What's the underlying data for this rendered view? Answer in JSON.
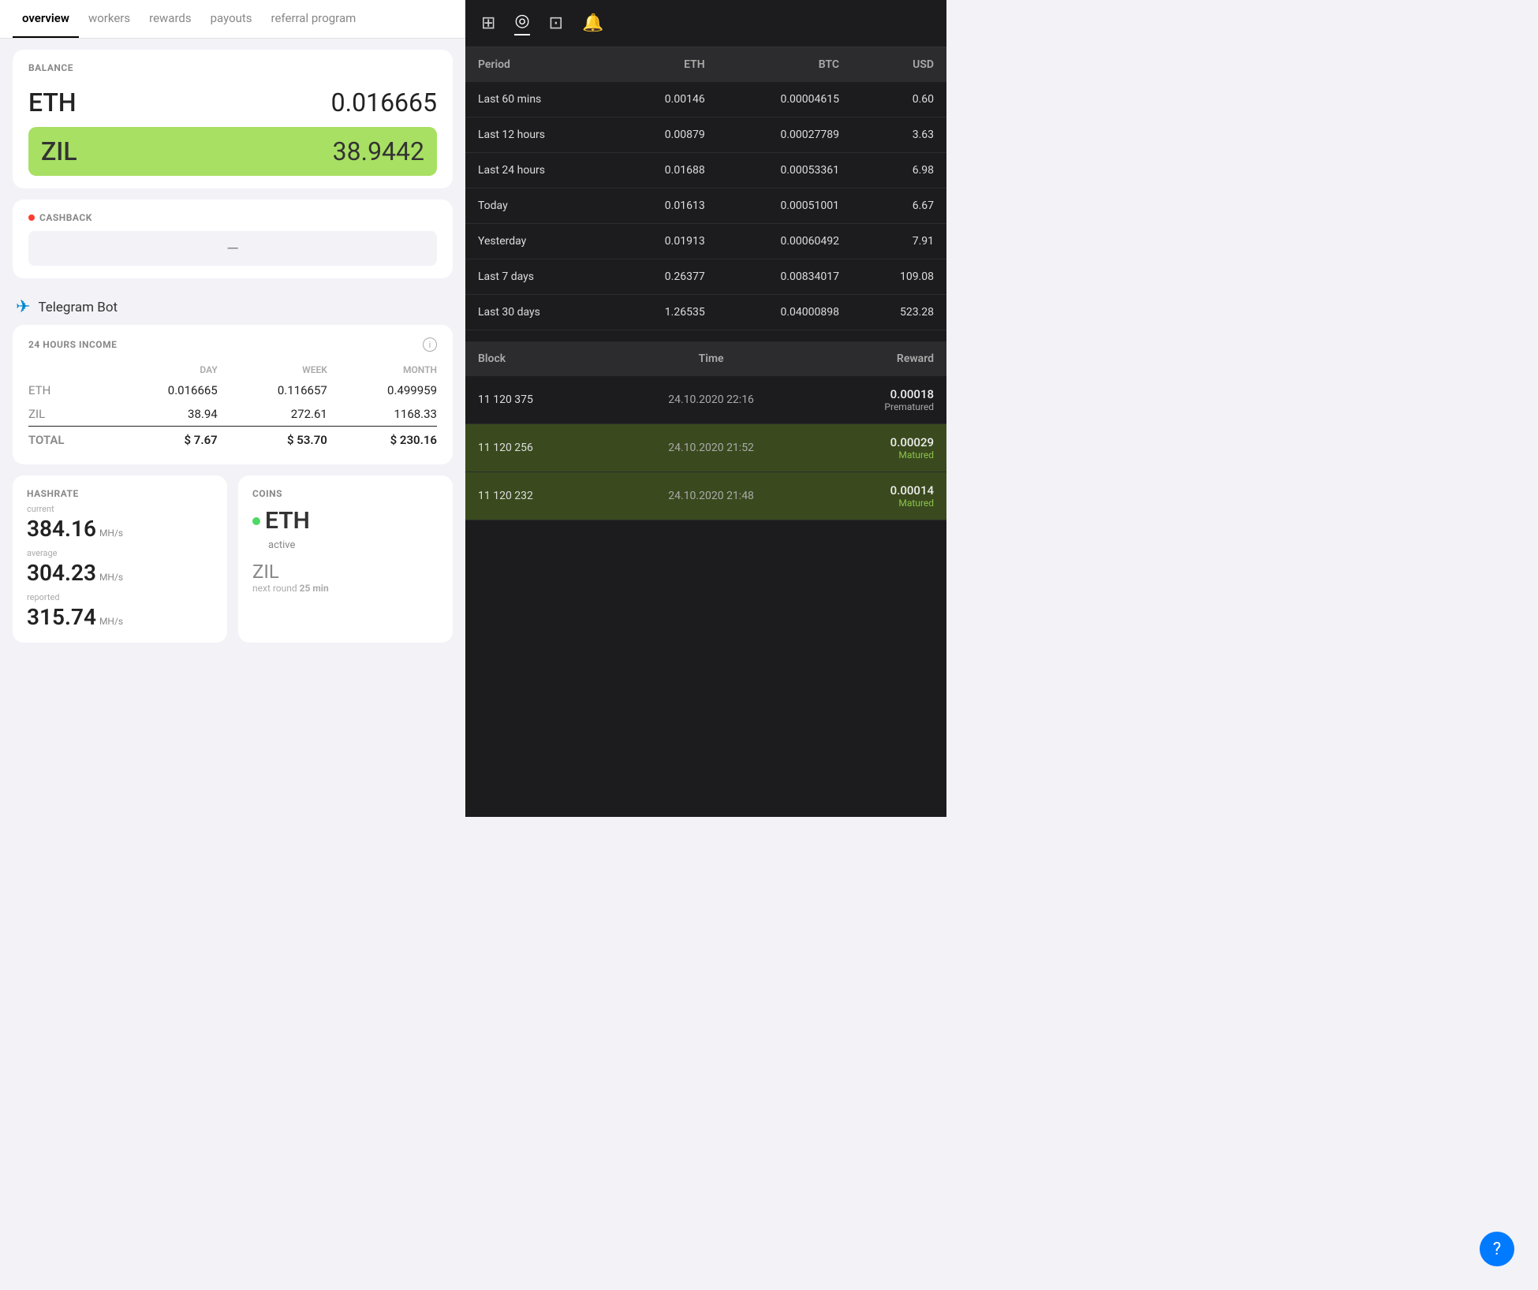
{
  "nav": {
    "tabs": [
      {
        "label": "overview",
        "active": true
      },
      {
        "label": "workers",
        "active": false
      },
      {
        "label": "rewards",
        "active": false
      },
      {
        "label": "payouts",
        "active": false
      },
      {
        "label": "referral program",
        "active": false
      }
    ]
  },
  "balance": {
    "label": "BALANCE",
    "eth": {
      "coin": "ETH",
      "amount": "0.016665"
    },
    "zil": {
      "coin": "ZIL",
      "amount": "38.9442"
    }
  },
  "cashback": {
    "label": "CASHBACK",
    "value": "—"
  },
  "telegram": {
    "label": "Telegram Bot"
  },
  "income": {
    "label": "24 HOURS INCOME",
    "columns": [
      "DAY",
      "WEEK",
      "MONTH"
    ],
    "rows": [
      {
        "coin": "ETH",
        "day": "0.016665",
        "week": "0.116657",
        "month": "0.499959"
      },
      {
        "coin": "ZIL",
        "day": "38.94",
        "week": "272.61",
        "month": "1168.33"
      }
    ],
    "total": {
      "label": "TOTAL",
      "day": "$ 7.67",
      "week": "$ 53.70",
      "month": "$ 230.16"
    }
  },
  "hashrate": {
    "label": "HASHRATE",
    "current_label": "current",
    "current_value": "384.16",
    "current_unit": "MH/s",
    "average_label": "average",
    "average_value": "304.23",
    "average_unit": "MH/s",
    "reported_label": "reported",
    "reported_value": "315.74",
    "reported_unit": "MH/s"
  },
  "coins": {
    "label": "COINS",
    "eth": {
      "name": "ETH",
      "status": "active"
    },
    "zil": {
      "name": "ZIL",
      "sub": "next round 25 min"
    }
  },
  "right_nav": {
    "icons": [
      "layers",
      "timer",
      "folder",
      "bell"
    ]
  },
  "rewards_table": {
    "columns": [
      "Period",
      "ETH",
      "BTC",
      "USD"
    ],
    "rows": [
      {
        "period": "Last 60 mins",
        "eth": "0.00146",
        "btc": "0.00004615",
        "usd": "0.60"
      },
      {
        "period": "Last 12 hours",
        "eth": "0.00879",
        "btc": "0.00027789",
        "usd": "3.63"
      },
      {
        "period": "Last 24 hours",
        "eth": "0.01688",
        "btc": "0.00053361",
        "usd": "6.98"
      },
      {
        "period": "Today",
        "eth": "0.01613",
        "btc": "0.00051001",
        "usd": "6.67"
      },
      {
        "period": "Yesterday",
        "eth": "0.01913",
        "btc": "0.00060492",
        "usd": "7.91"
      },
      {
        "period": "Last 7 days",
        "eth": "0.26377",
        "btc": "0.00834017",
        "usd": "109.08"
      },
      {
        "period": "Last 30 days",
        "eth": "1.26535",
        "btc": "0.04000898",
        "usd": "523.28"
      }
    ]
  },
  "blocks_table": {
    "columns": [
      "Block",
      "Time",
      "Reward"
    ],
    "rows": [
      {
        "block": "11 120 375",
        "time": "24.10.2020 22:16",
        "reward": "0.00018",
        "status": "Prematured",
        "matured": false
      },
      {
        "block": "11 120 256",
        "time": "24.10.2020 21:52",
        "reward": "0.00029",
        "status": "Matured",
        "matured": true
      },
      {
        "block": "11 120 232",
        "time": "24.10.2020 21:48",
        "reward": "0.00014",
        "status": "Matured",
        "matured": true
      }
    ]
  }
}
